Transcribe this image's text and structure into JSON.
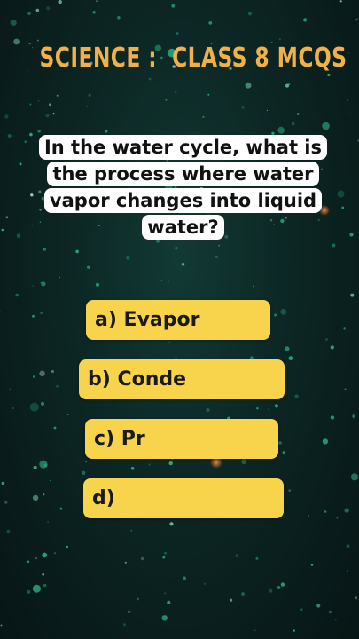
{
  "header": {
    "title": "SCIENCE :  CLASS 8 MCQS"
  },
  "question": {
    "lines": [
      "In the water cycle, what is",
      "the process where water",
      "vapor changes into liquid",
      "water?"
    ]
  },
  "options": [
    {
      "label": "a) Evapor"
    },
    {
      "label": "b) Conde"
    },
    {
      "label": "c) Pr"
    },
    {
      "label": "d)"
    }
  ],
  "colors": {
    "title": "#f0b04a",
    "option_bg": "#f7d44c",
    "question_bg": "#ffffff",
    "background": "#0c2624"
  }
}
